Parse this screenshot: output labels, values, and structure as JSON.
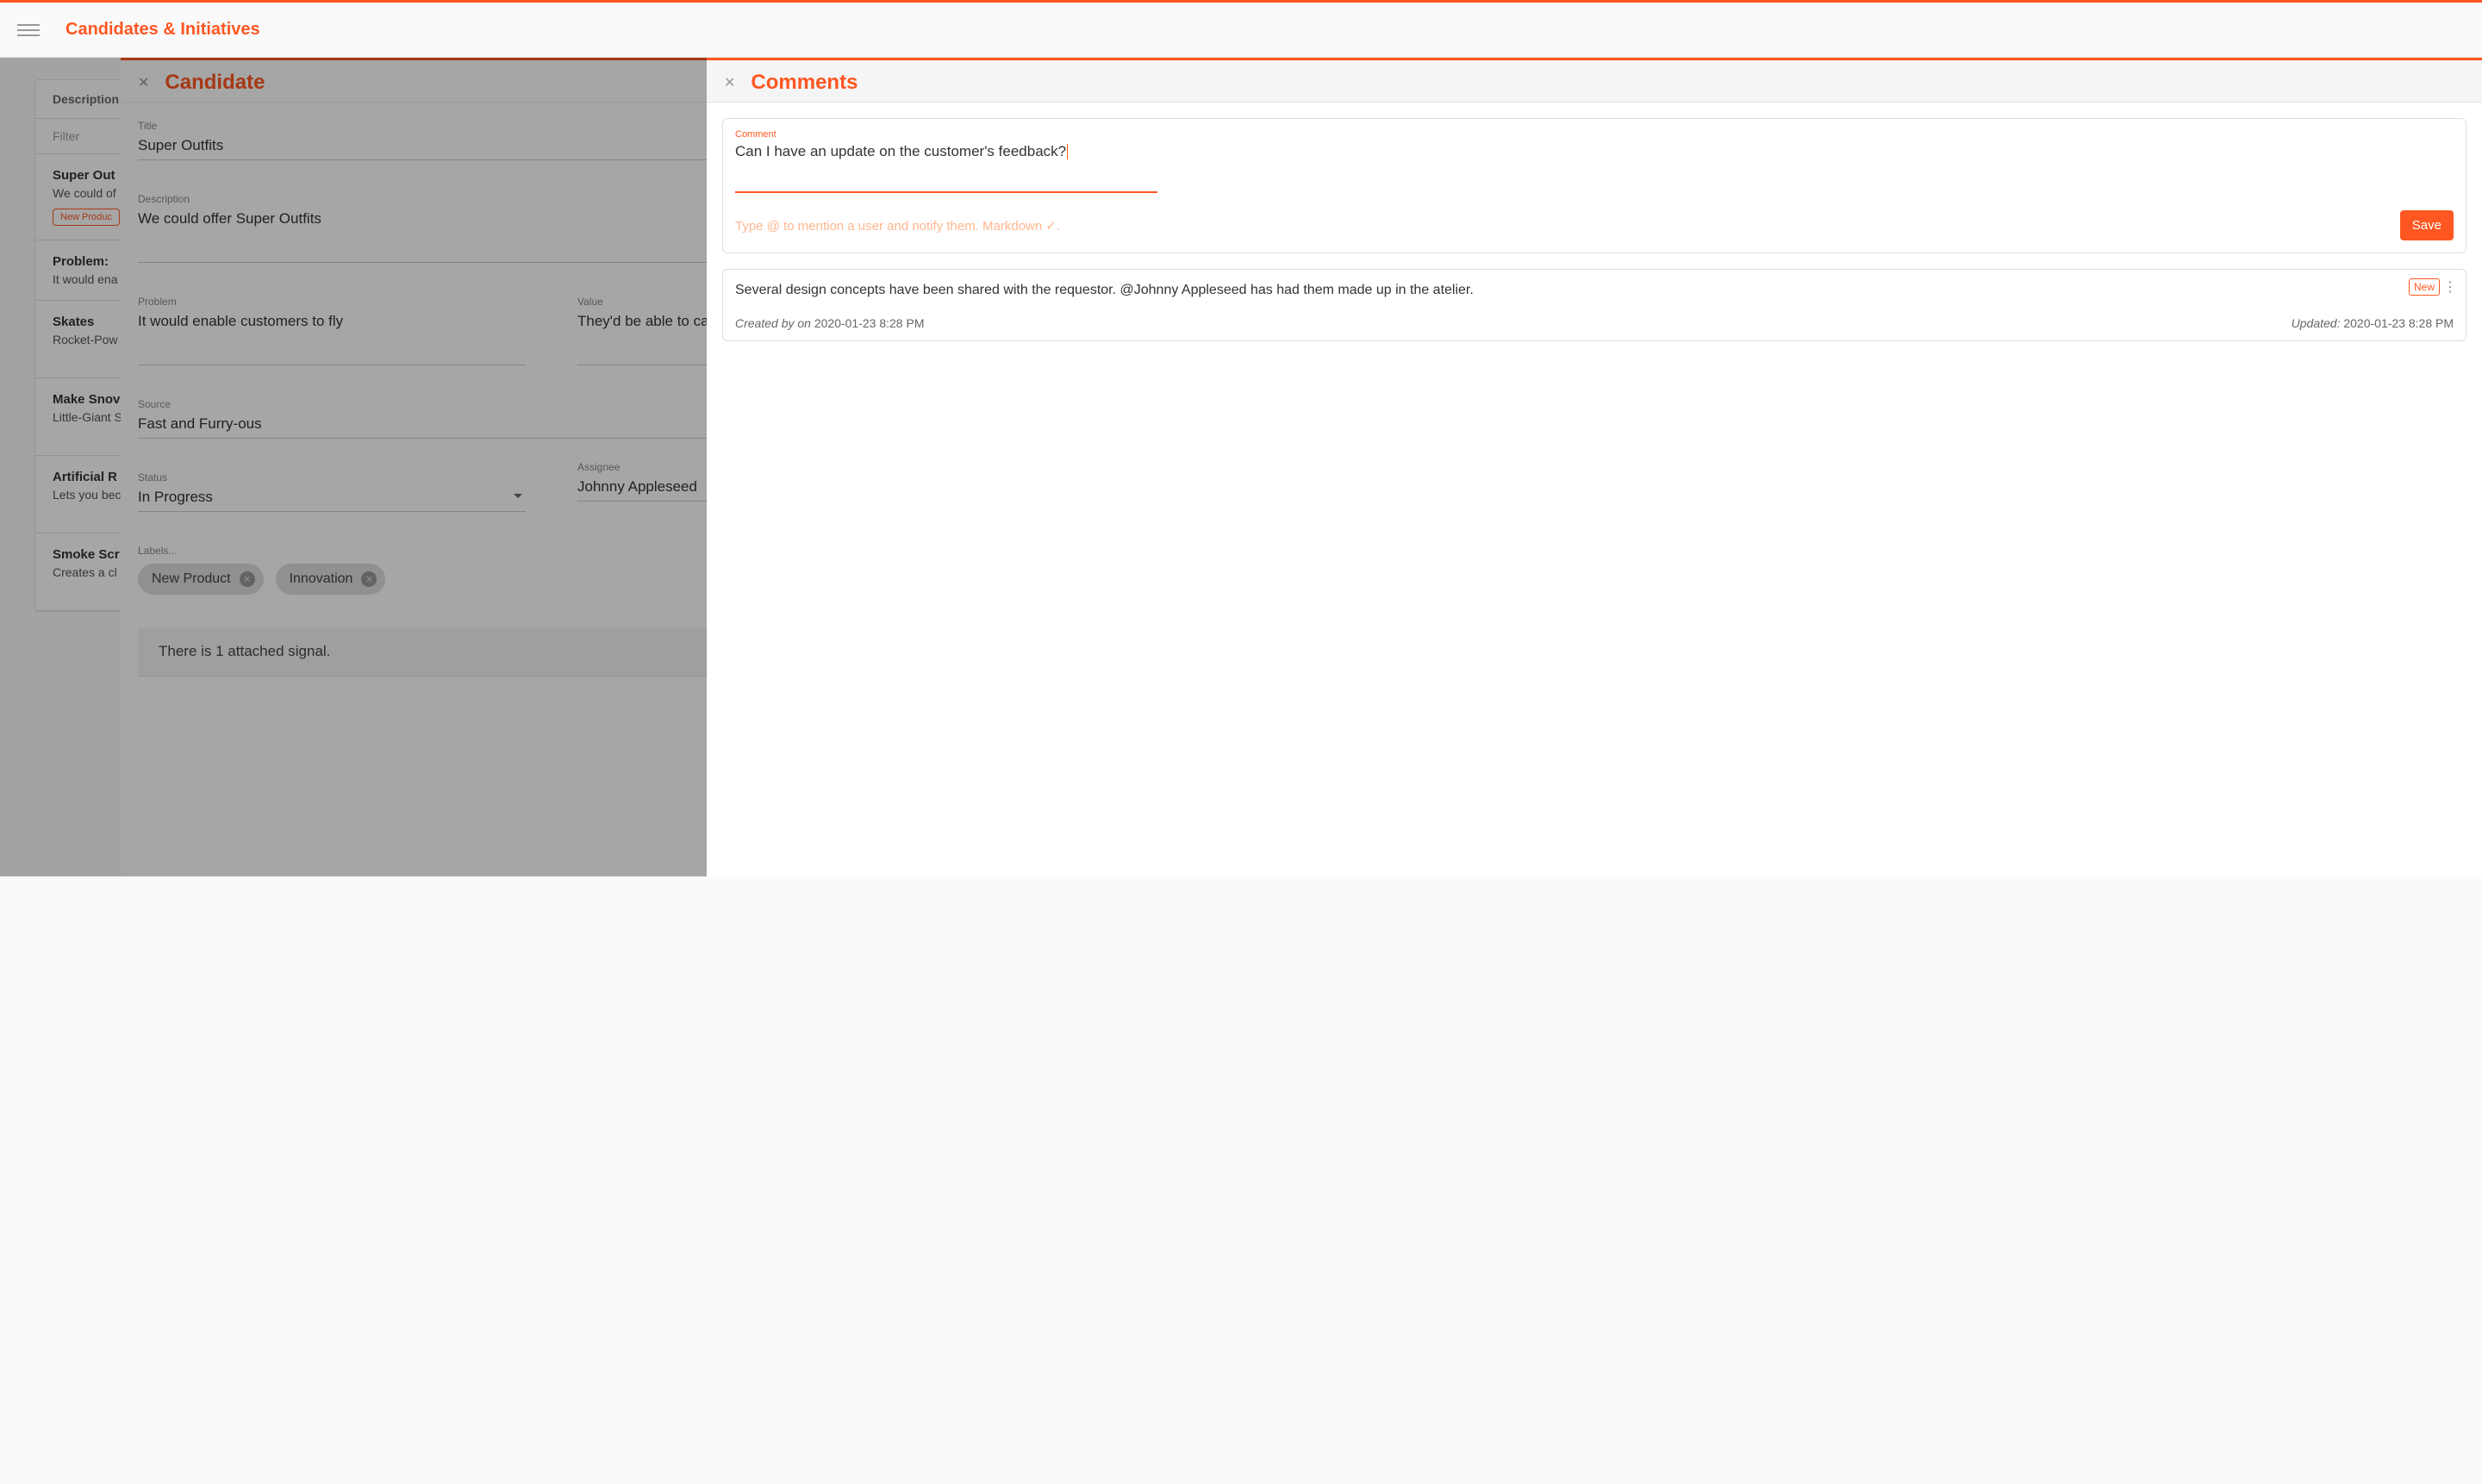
{
  "header": {
    "title": "Candidates & Initiatives"
  },
  "background_list": {
    "tab_description": "Description",
    "filter_placeholder": "Filter",
    "items": [
      {
        "title": "Super Out",
        "desc": "We could of",
        "label": "New Produc"
      },
      {
        "title": "Problem:",
        "desc": "It would ena"
      },
      {
        "title": "Skates",
        "desc": "Rocket-Pow"
      },
      {
        "title": "Make Snov",
        "desc": "Little-Giant S"
      },
      {
        "title": "Artificial R",
        "desc": "Lets you bec"
      },
      {
        "title": "Smoke Scr",
        "desc": "Creates a cl"
      }
    ]
  },
  "candidate": {
    "panel_title": "Candidate",
    "fields": {
      "title_label": "Title",
      "title_value": "Super Outfits",
      "description_label": "Description",
      "description_value": "We could offer Super Outfits",
      "problem_label": "Problem",
      "problem_value": "It would enable customers to fly",
      "value_label": "Value",
      "value_value": "They'd be able to capture their prey or es",
      "source_label": "Source",
      "source_value": "Fast and Furry-ous",
      "status_label": "Status",
      "status_value": "In Progress",
      "assignee_label": "Assignee",
      "assignee_value": "Johnny Appleseed",
      "labels_label": "Labels..."
    },
    "chips": [
      "New Product",
      "Innovation"
    ],
    "signal_text": "There is 1 attached signal."
  },
  "comments": {
    "panel_title": "Comments",
    "input_label": "Comment",
    "input_value": "Can I have an update on the customer's feedback?",
    "helper_text": "Type @ to mention a user and notify them. Markdown ✓.",
    "save_button": "Save",
    "items": [
      {
        "text": "Several design concepts have been shared with the requestor. @Johnny Appleseed has had them made up in the atelier.",
        "badge": "New",
        "created_label": "Created by on",
        "created_value": "2020-01-23 8:28 PM",
        "updated_label": "Updated:",
        "updated_value": "2020-01-23 8:28 PM"
      }
    ]
  }
}
